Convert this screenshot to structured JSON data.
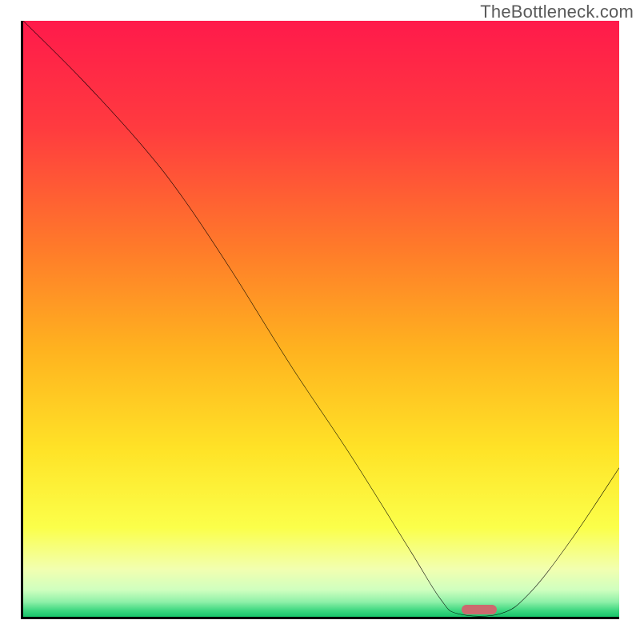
{
  "watermark": "TheBottleneck.com",
  "chart_data": {
    "type": "line",
    "title": "",
    "xlabel": "",
    "ylabel": "",
    "xlim": [
      0,
      100
    ],
    "ylim": [
      0,
      100
    ],
    "grid": false,
    "series": [
      {
        "name": "curve",
        "x": [
          0,
          10,
          20,
          27,
          35,
          45,
          55,
          65,
          70,
          73,
          80,
          85,
          92,
          100
        ],
        "y": [
          100,
          90,
          79,
          70,
          58,
          42,
          27,
          11,
          3,
          0.5,
          0.5,
          4,
          13,
          25
        ]
      }
    ],
    "marker": {
      "x": 76.5,
      "y": 1.2,
      "w": 6,
      "h": 1.6
    },
    "gradient_stops": [
      {
        "offset": 0,
        "color": "#ff1a4b"
      },
      {
        "offset": 0.18,
        "color": "#ff3b3f"
      },
      {
        "offset": 0.38,
        "color": "#ff7a2a"
      },
      {
        "offset": 0.55,
        "color": "#ffb21f"
      },
      {
        "offset": 0.72,
        "color": "#ffe327"
      },
      {
        "offset": 0.85,
        "color": "#fbff4a"
      },
      {
        "offset": 0.92,
        "color": "#f2ffb0"
      },
      {
        "offset": 0.955,
        "color": "#cfffbf"
      },
      {
        "offset": 0.975,
        "color": "#8ef0a8"
      },
      {
        "offset": 0.99,
        "color": "#3ad67e"
      },
      {
        "offset": 1.0,
        "color": "#18c46a"
      }
    ]
  }
}
